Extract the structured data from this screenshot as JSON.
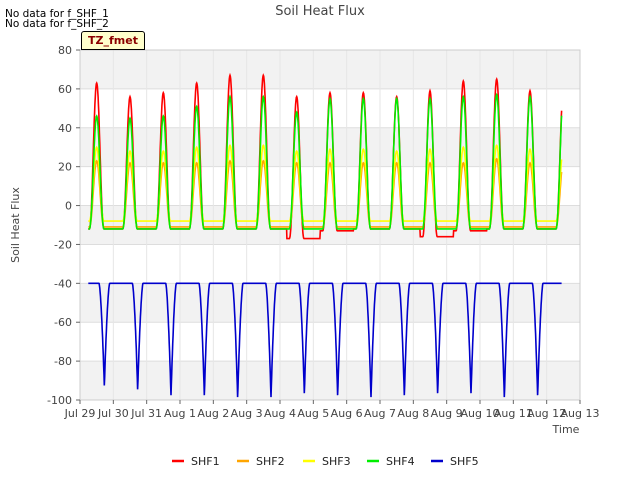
{
  "notes": [
    "No data for f_SHF_1",
    "No data for f_SHF_2"
  ],
  "site_tag": "TZ_fmet",
  "chart_data": {
    "type": "line",
    "title": "Soil Heat Flux",
    "xlabel": "Time",
    "ylabel": "Soil Heat Flux",
    "ylim": [
      -100,
      80
    ],
    "yticks": [
      -100,
      -80,
      -60,
      -40,
      -20,
      0,
      20,
      40,
      60,
      80
    ],
    "xlim": [
      0,
      15
    ],
    "xticks": [
      0,
      1,
      2,
      3,
      4,
      5,
      6,
      7,
      8,
      9,
      10,
      11,
      12,
      13,
      14,
      15
    ],
    "xtick_labels": [
      "Jul 29",
      "Jul 30",
      "Jul 31",
      "Aug 1",
      "Aug 2",
      "Aug 3",
      "Aug 4",
      "Aug 5",
      "Aug 6",
      "Aug 7",
      "Aug 8",
      "Aug 9",
      "Aug 10",
      "Aug 11",
      "Aug 12",
      "Aug 13"
    ],
    "grid": true,
    "legend_position": "bottom",
    "x_start": 0.25,
    "x_end": 14.45,
    "series": [
      {
        "name": "SHF1",
        "color": "#ff0000",
        "kind": "diurnal",
        "daily_peak": [
          63,
          56,
          58,
          63,
          67,
          67,
          56,
          58,
          58,
          56,
          59,
          64,
          65,
          59
        ],
        "night_level": [
          -12,
          -12,
          -12,
          -12,
          -12,
          -12,
          -17,
          -13,
          -12,
          -12,
          -16,
          -13,
          -12,
          -12
        ]
      },
      {
        "name": "SHF2",
        "color": "#ffa500",
        "kind": "diurnal",
        "daily_peak": [
          23,
          22,
          22,
          22,
          23,
          23,
          22,
          22,
          22,
          22,
          22,
          22,
          24,
          22
        ],
        "night_level": [
          -11,
          -11,
          -11,
          -11,
          -11,
          -11,
          -11,
          -11,
          -11,
          -11,
          -11,
          -11,
          -11,
          -11
        ]
      },
      {
        "name": "SHF3",
        "color": "#ffff00",
        "kind": "diurnal",
        "daily_peak": [
          30,
          28,
          28,
          30,
          31,
          31,
          28,
          29,
          29,
          28,
          29,
          30,
          31,
          29
        ],
        "night_level": [
          -8,
          -8,
          -8,
          -8,
          -8,
          -8,
          -8,
          -8,
          -8,
          -8,
          -8,
          -8,
          -8,
          -8
        ]
      },
      {
        "name": "SHF4",
        "color": "#00ee00",
        "kind": "diurnal",
        "daily_peak": [
          46,
          45,
          46,
          51,
          56,
          56,
          48,
          55,
          55,
          55,
          55,
          56,
          57,
          56
        ],
        "night_level": [
          -12,
          -12,
          -12,
          -12,
          -12,
          -12,
          -12,
          -12,
          -12,
          -12,
          -12,
          -12,
          -12,
          -12
        ]
      },
      {
        "name": "SHF5",
        "color": "#0000cc",
        "kind": "trough",
        "daily_min": [
          -93,
          -95,
          -98,
          -98,
          -99,
          -99,
          -97,
          -98,
          -99,
          -98,
          -97,
          -97,
          -99,
          -98
        ],
        "baseline": -40
      }
    ]
  }
}
